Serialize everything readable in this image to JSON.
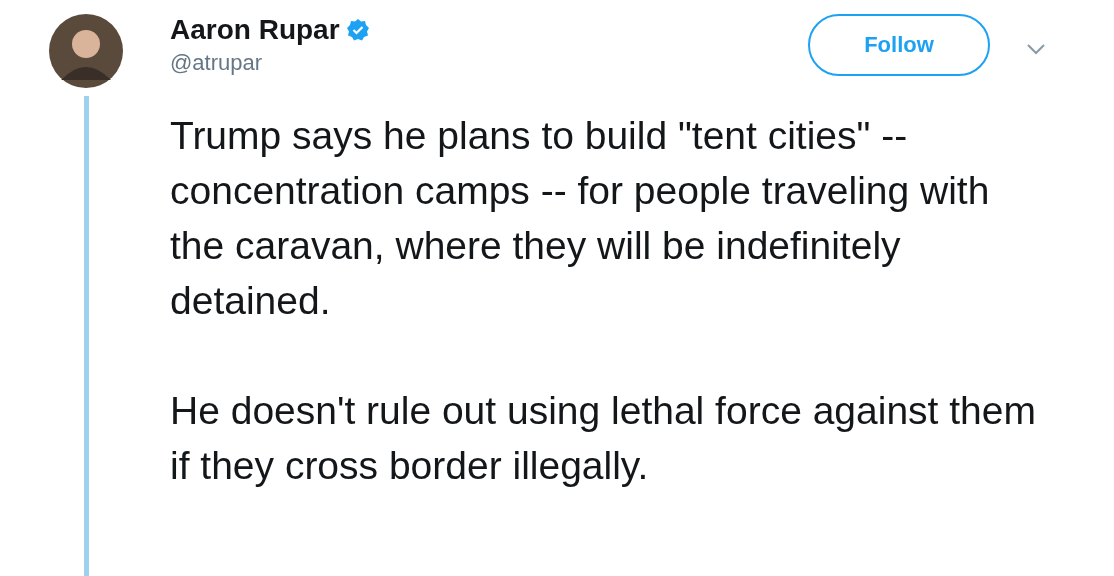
{
  "author": {
    "name": "Aaron Rupar",
    "verified": true,
    "handle": "@atrupar"
  },
  "follow_button": {
    "label": "Follow"
  },
  "tweet": {
    "paragraphs": [
      "Trump says he plans to build \"tent cities\" -- concentration camps -- for people traveling with the caravan, where they will be indefinitely detained.",
      "He doesn't rule out using lethal force against them if they cross border illegally."
    ]
  }
}
